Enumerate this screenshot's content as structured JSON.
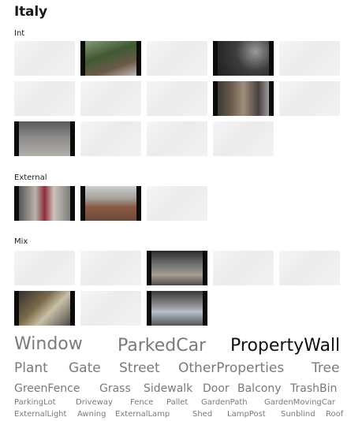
{
  "page": {
    "title": "Italy"
  },
  "sections": [
    {
      "label": "Int",
      "thumbs": [
        {
          "scene": "wall",
          "faded": true
        },
        {
          "scene": "garden",
          "faded": false
        },
        {
          "scene": "wall",
          "faded": true
        },
        {
          "scene": "night-street",
          "faded": false
        },
        {
          "scene": "wall",
          "faded": true
        },
        {
          "scene": "wall",
          "faded": true
        },
        {
          "scene": "wall",
          "faded": true
        },
        {
          "scene": "wall",
          "faded": true
        },
        {
          "scene": "alley",
          "faded": false
        },
        {
          "scene": "wall",
          "faded": true
        },
        {
          "scene": "courtyard",
          "faded": false
        },
        {
          "scene": "wall",
          "faded": true
        },
        {
          "scene": "wall",
          "faded": true
        },
        {
          "scene": "wall",
          "faded": true
        }
      ]
    },
    {
      "label": "External",
      "thumbs": [
        {
          "scene": "street-person",
          "faded": false
        },
        {
          "scene": "rooftops",
          "faded": false
        },
        {
          "scene": "wall",
          "faded": true
        }
      ]
    },
    {
      "label": "Mix",
      "thumbs": [
        {
          "scene": "wall",
          "faded": true
        },
        {
          "scene": "wall",
          "faded": true
        },
        {
          "scene": "stairs",
          "faded": false
        },
        {
          "scene": "wall",
          "faded": true
        },
        {
          "scene": "wall",
          "faded": true
        },
        {
          "scene": "gate",
          "faded": false
        },
        {
          "scene": "wall",
          "faded": true
        },
        {
          "scene": "parked-car",
          "faded": false
        }
      ]
    }
  ],
  "tags": [
    {
      "label": "Window",
      "size": "xl",
      "active": false
    },
    {
      "label": "ParkedCar",
      "size": "xl",
      "active": false
    },
    {
      "label": "PropertyWall",
      "size": "xl",
      "active": true
    },
    {
      "label": "Plant",
      "size": "l",
      "active": false
    },
    {
      "label": "Gate",
      "size": "l",
      "active": false
    },
    {
      "label": "Street",
      "size": "l",
      "active": false
    },
    {
      "label": "OtherProperties",
      "size": "l",
      "active": false
    },
    {
      "label": "Tree",
      "size": "l",
      "active": false
    },
    {
      "label": "GreenFence",
      "size": "m",
      "active": false
    },
    {
      "label": "Grass",
      "size": "m",
      "active": false
    },
    {
      "label": "Sidewalk",
      "size": "m",
      "active": false
    },
    {
      "label": "Door",
      "size": "m",
      "active": false
    },
    {
      "label": "Balcony",
      "size": "m",
      "active": false
    },
    {
      "label": "TrashBin",
      "size": "m",
      "active": false
    },
    {
      "label": "ParkingLot",
      "size": "s",
      "active": false
    },
    {
      "label": "Driveway",
      "size": "s",
      "active": false
    },
    {
      "label": "Fence",
      "size": "s",
      "active": false
    },
    {
      "label": "Pallet",
      "size": "s",
      "active": false
    },
    {
      "label": "GardenPath",
      "size": "s",
      "active": false
    },
    {
      "label": "GardenMovingCar",
      "size": "s",
      "active": false
    },
    {
      "label": "ExternalLight",
      "size": "s",
      "active": false
    },
    {
      "label": "Awning",
      "size": "s",
      "active": false
    },
    {
      "label": "ExternalLamp",
      "size": "s",
      "active": false
    },
    {
      "label": "Shed",
      "size": "s",
      "active": false
    },
    {
      "label": "LampPost",
      "size": "s",
      "active": false
    },
    {
      "label": "Sunblind",
      "size": "s",
      "active": false
    },
    {
      "label": "Roof",
      "size": "s",
      "active": false
    }
  ],
  "colors": {
    "tag_inactive": "#7a7a7a",
    "tag_active": "#111111",
    "letterbox": "#0b0b0b"
  }
}
